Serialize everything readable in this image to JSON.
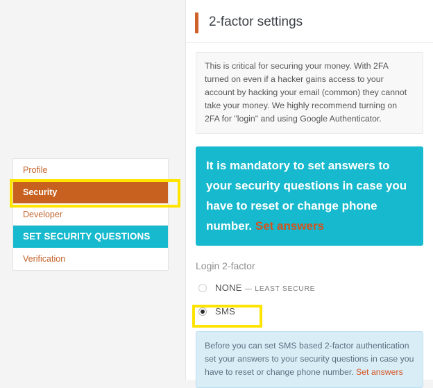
{
  "sidebar": {
    "items": [
      {
        "label": "Profile",
        "style": "plain"
      },
      {
        "label": "Security",
        "style": "active"
      },
      {
        "label": "Developer",
        "style": "plain"
      },
      {
        "label": "SET SECURITY QUESTIONS",
        "style": "cyan"
      },
      {
        "label": "Verification",
        "style": "plain"
      }
    ]
  },
  "panel": {
    "title": "2-factor settings",
    "description": "This is critical for securing your money. With 2FA turned on even if a hacker gains access to your account by hacking your email (common) they cannot take your money. We highly recommend turning on 2FA for \"login\" and using Google Authenticator.",
    "banner": {
      "text": "It is mandatory to set answers to your security questions in case you have to reset or change phone number.",
      "link_label": "Set answers"
    },
    "field_label": "Login 2-factor",
    "options": [
      {
        "label": "NONE",
        "sub_label": "— LEAST SECURE",
        "selected": false
      },
      {
        "label": "SMS",
        "sub_label": "",
        "selected": true
      }
    ],
    "info": {
      "text": "Before you can set SMS based 2-factor authentication set your answers to your security questions in case you have to reset or change phone number.",
      "link_label": "Set answers"
    }
  },
  "colors": {
    "accent_orange": "#c8601f",
    "cyan": "#16b9cd",
    "link_orange": "#d4521e",
    "highlight_yellow": "#ffe400",
    "info_blue_bg": "#d9edf7"
  }
}
